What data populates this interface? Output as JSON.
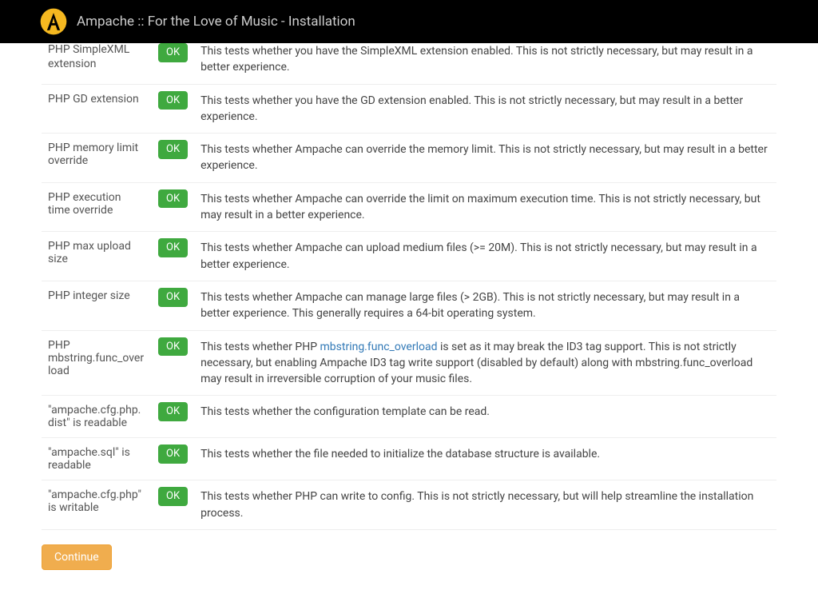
{
  "header": {
    "title": "Ampache :: For the Love of Music - Installation"
  },
  "status_label": "OK",
  "checks": [
    {
      "name": "PHP SimpleXML extension",
      "desc_pre": "This tests whether you have the SimpleXML extension enabled. This is not strictly necessary, but may result in a better experience.",
      "link": "",
      "desc_post": ""
    },
    {
      "name": "PHP GD extension",
      "desc_pre": "This tests whether you have the GD extension enabled. This is not strictly necessary, but may result in a better experience.",
      "link": "",
      "desc_post": ""
    },
    {
      "name": "PHP memory limit override",
      "desc_pre": "This tests whether Ampache can override the memory limit. This is not strictly necessary, but may result in a better experience.",
      "link": "",
      "desc_post": ""
    },
    {
      "name": "PHP execution time override",
      "desc_pre": "This tests whether Ampache can override the limit on maximum execution time. This is not strictly necessary, but may result in a better experience.",
      "link": "",
      "desc_post": ""
    },
    {
      "name": "PHP max upload size",
      "desc_pre": "This tests whether Ampache can upload medium files (>= 20M). This is not strictly necessary, but may result in a better experience.",
      "link": "",
      "desc_post": ""
    },
    {
      "name": "PHP integer size",
      "desc_pre": "This tests whether Ampache can manage large files (> 2GB). This is not strictly necessary, but may result in a better experience. This generally requires a 64-bit operating system.",
      "link": "",
      "desc_post": ""
    },
    {
      "name": "PHP mbstring.func_overload",
      "desc_pre": "This tests whether PHP ",
      "link": "mbstring.func_overload",
      "desc_post": " is set as it may break the ID3 tag support. This is not strictly necessary, but enabling Ampache ID3 tag write support (disabled by default) along with mbstring.func_overload may result in irreversible corruption of your music files."
    },
    {
      "name": "\"ampache.cfg.php.dist\" is readable",
      "desc_pre": "This tests whether the configuration template can be read.",
      "link": "",
      "desc_post": ""
    },
    {
      "name": "\"ampache.sql\" is readable",
      "desc_pre": "This tests whether the file needed to initialize the database structure is available.",
      "link": "",
      "desc_post": ""
    },
    {
      "name": "\"ampache.cfg.php\" is writable",
      "desc_pre": "This tests whether PHP can write to config. This is not strictly necessary, but will help streamline the installation process.",
      "link": "",
      "desc_post": ""
    }
  ],
  "continue_label": "Continue"
}
